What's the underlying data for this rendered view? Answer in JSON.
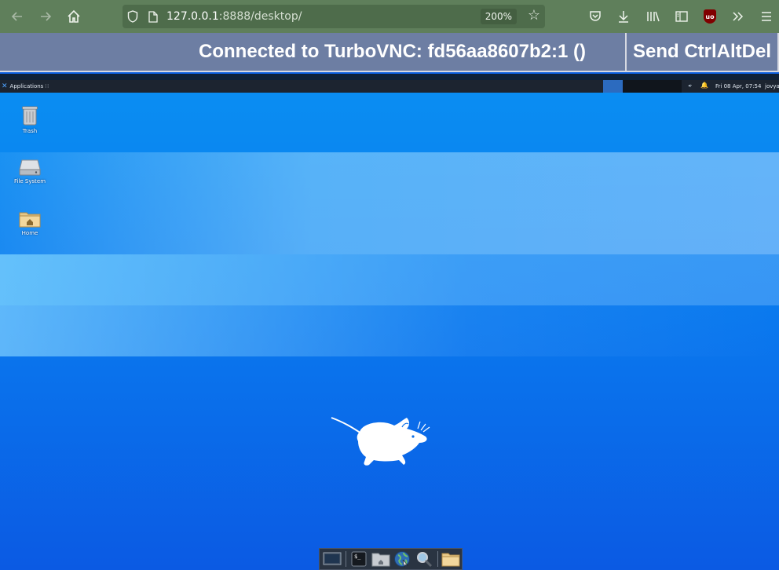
{
  "browser": {
    "url_host": "127.0.0.1",
    "url_rest": ":8888/desktop/",
    "zoom": "200%",
    "icons": [
      "back-arrow-icon",
      "forward-arrow-icon",
      "home-icon",
      "shield-icon",
      "page-icon",
      "star-icon",
      "pocket-icon",
      "download-icon",
      "library-icon",
      "sidebar-icon",
      "ublock-icon",
      "overflow-icon",
      "menu-icon"
    ],
    "ublock_label": "uo"
  },
  "vnc": {
    "status": "Connected to TurboVNC: fd56aa8607b2:1 ()",
    "send_button": "Send CtrlAltDel"
  },
  "desktop": {
    "panel": {
      "applications": "Applications ∷",
      "clock": "Fri 08 Apr, 07:54",
      "user": "jovyan"
    },
    "icons": [
      {
        "label": "Trash"
      },
      {
        "label": "File System"
      },
      {
        "label": "Home"
      }
    ],
    "dock": [
      "desktop-icon",
      "terminal-icon",
      "home-folder-icon",
      "web-browser-icon",
      "search-icon",
      "folder-icon"
    ]
  },
  "colors": {
    "browser_bar": "#5f7f5b",
    "vnc_bar": "#6d7ea3",
    "desktop_top": "#0a8ff2",
    "desktop_bottom": "#0b5ae3"
  }
}
